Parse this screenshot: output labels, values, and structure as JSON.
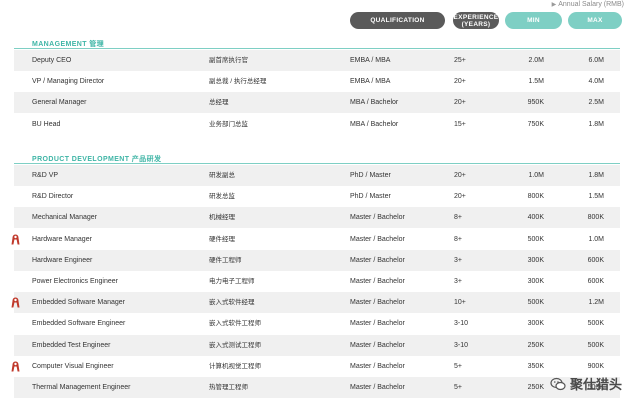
{
  "header": {
    "note": "Annual Salary (RMB)",
    "qualification": "QUALIFICATION",
    "experience_line1": "EXPERIENCE",
    "experience_line2": "(YEARS)",
    "min": "MIN",
    "max": "MAX"
  },
  "sections": [
    {
      "title": "MANAGEMENT 管理",
      "rows": [
        {
          "en": "Deputy CEO",
          "zh": "副首席执行官",
          "qual": "EMBA / MBA",
          "exp": "25+",
          "min": "2.0M",
          "max": "6.0M",
          "flag": false
        },
        {
          "en": "VP / Managing Director",
          "zh": "副总裁 / 执行总经理",
          "qual": "EMBA / MBA",
          "exp": "20+",
          "min": "1.5M",
          "max": "4.0M",
          "flag": false
        },
        {
          "en": "General Manager",
          "zh": "总经理",
          "qual": "MBA / Bachelor",
          "exp": "20+",
          "min": "950K",
          "max": "2.5M",
          "flag": false
        },
        {
          "en": "BU Head",
          "zh": "业务部门总监",
          "qual": "MBA / Bachelor",
          "exp": "15+",
          "min": "750K",
          "max": "1.8M",
          "flag": false
        }
      ]
    },
    {
      "title": "PRODUCT DEVELOPMENT 产品研发",
      "rows": [
        {
          "en": "R&D VP",
          "zh": "研发副总",
          "qual": "PhD / Master",
          "exp": "20+",
          "min": "1.0M",
          "max": "1.8M",
          "flag": false
        },
        {
          "en": "R&D Director",
          "zh": "研发总监",
          "qual": "PhD / Master",
          "exp": "20+",
          "min": "800K",
          "max": "1.5M",
          "flag": false
        },
        {
          "en": "Mechanical Manager",
          "zh": "机械经理",
          "qual": "Master / Bachelor",
          "exp": "8+",
          "min": "400K",
          "max": "800K",
          "flag": false
        },
        {
          "en": "Hardware Manager",
          "zh": "硬件经理",
          "qual": "Master / Bachelor",
          "exp": "8+",
          "min": "500K",
          "max": "1.0M",
          "flag": true
        },
        {
          "en": "Hardware Engineer",
          "zh": "硬件工程师",
          "qual": "Master / Bachelor",
          "exp": "3+",
          "min": "300K",
          "max": "600K",
          "flag": false
        },
        {
          "en": "Power Electronics Engineer",
          "zh": "电力电子工程师",
          "qual": "Master / Bachelor",
          "exp": "3+",
          "min": "300K",
          "max": "600K",
          "flag": false
        },
        {
          "en": "Embedded Software Manager",
          "zh": "嵌入式软件经理",
          "qual": "Master / Bachelor",
          "exp": "10+",
          "min": "500K",
          "max": "1.2M",
          "flag": true
        },
        {
          "en": "Embedded Software Engineer",
          "zh": "嵌入式软件工程师",
          "qual": "Master / Bachelor",
          "exp": "3-10",
          "min": "300K",
          "max": "500K",
          "flag": false
        },
        {
          "en": "Embedded Test Engineer",
          "zh": "嵌入式测试工程师",
          "qual": "Master / Bachelor",
          "exp": "3-10",
          "min": "250K",
          "max": "500K",
          "flag": false
        },
        {
          "en": "Computer Visual Engineer",
          "zh": "计算机视觉工程师",
          "qual": "Master / Bachelor",
          "exp": "5+",
          "min": "350K",
          "max": "900K",
          "flag": true
        },
        {
          "en": "Thermal Management Engineer",
          "zh": "热管理工程师",
          "qual": "Master / Bachelor",
          "exp": "5+",
          "min": "250K",
          "max": "500K",
          "flag": false
        }
      ]
    }
  ],
  "watermark": "聚仕猎头",
  "colors": {
    "teal": "#7ecfc4",
    "teal_text": "#3fb5a6",
    "dark_pill": "#5a5a5a",
    "row_alt": "#f0f0f0",
    "flag": "#c0392b"
  },
  "icons": {
    "flag": "person-flag-icon",
    "watermark": "wechat-icon"
  }
}
